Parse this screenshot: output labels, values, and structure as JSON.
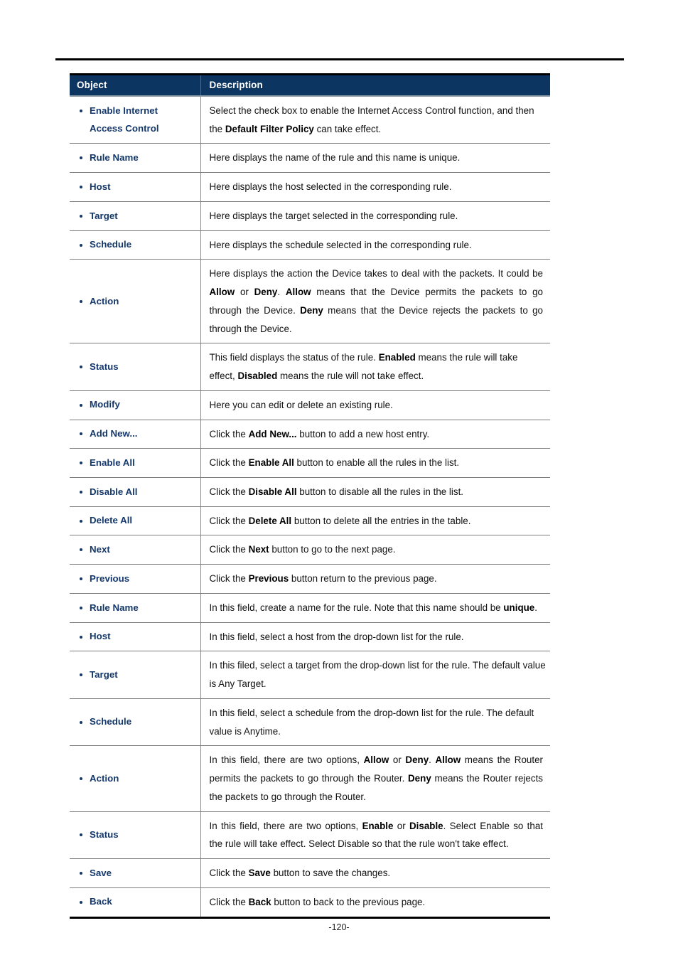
{
  "document": {
    "page_number": "-120-",
    "header_rule": true
  },
  "table": {
    "columns": [
      "Object",
      "Description"
    ],
    "rows": [
      {
        "object_lines": [
          "Enable Internet",
          "Access Control"
        ],
        "description_html": "Select the check box to enable the Internet Access Control function, and then the <b>Default Filter Policy</b> can take effect.",
        "justified": false
      },
      {
        "object_lines": [
          "Rule Name"
        ],
        "description_html": "Here displays the name of the rule and this name is unique.",
        "justified": false
      },
      {
        "object_lines": [
          "Host"
        ],
        "description_html": "Here displays the host selected in the corresponding rule.",
        "justified": false
      },
      {
        "object_lines": [
          "Target"
        ],
        "description_html": "Here displays the target selected in the corresponding rule.",
        "justified": false
      },
      {
        "object_lines": [
          "Schedule"
        ],
        "description_html": "Here displays the schedule selected in the corresponding rule.",
        "justified": false
      },
      {
        "object_lines": [
          "Action"
        ],
        "description_html": "Here displays the action the Device takes to deal with the packets. It could be <b>Allow</b> or <b>Deny</b>. <b>Allow</b> means that the Device permits the packets to go through the Device. <b>Deny</b> means that the Device rejects the packets to go through the Device.",
        "justified": true
      },
      {
        "object_lines": [
          "Status"
        ],
        "description_html": "This field displays the status of the rule. <b>Enabled</b> means the rule will take effect, <b>Disabled</b> means the rule will not take effect.",
        "justified": false
      },
      {
        "object_lines": [
          "Modify"
        ],
        "description_html": "Here you can edit or delete an existing rule.",
        "justified": false
      },
      {
        "object_lines": [
          "Add New..."
        ],
        "description_html": "Click the <b>Add New...</b> button to add a new host entry.",
        "justified": false
      },
      {
        "object_lines": [
          "Enable All"
        ],
        "description_html": "Click the <b>Enable All</b> button to enable all the rules in the list.",
        "justified": false
      },
      {
        "object_lines": [
          "Disable All"
        ],
        "description_html": "Click the <b>Disable All</b> button to disable all the rules in the list.",
        "justified": false
      },
      {
        "object_lines": [
          "Delete All"
        ],
        "description_html": "Click the <b>Delete All</b> button to delete all the entries in the table.",
        "justified": false
      },
      {
        "object_lines": [
          "Next"
        ],
        "description_html": "Click the <b>Next</b> button to go to the next page.",
        "justified": false
      },
      {
        "object_lines": [
          "Previous"
        ],
        "description_html": "Click the <b>Previous</b> button return to the previous page.",
        "justified": false
      },
      {
        "object_lines": [
          "Rule Name"
        ],
        "description_html": "In this field, create a name for the rule. Note that this name should be <b>unique</b>.",
        "justified": true
      },
      {
        "object_lines": [
          "Host"
        ],
        "description_html": "In this field, select a host from the drop-down list for the rule.",
        "justified": false
      },
      {
        "object_lines": [
          "Target"
        ],
        "description_html": "In this filed, select a target from the drop-down list for the rule. The default value is Any Target.",
        "justified": false
      },
      {
        "object_lines": [
          "Schedule"
        ],
        "description_html": "In this field, select a schedule from the drop-down list for the rule. The default value is Anytime.",
        "justified": false
      },
      {
        "object_lines": [
          "Action"
        ],
        "description_html": "In this field, there are two options, <b>Allow</b> or <b>Deny</b>. <b>Allow</b> means the Router permits the packets to go through the Router. <b>Deny</b> means the Router rejects the packets to go through the Router.",
        "justified": true
      },
      {
        "object_lines": [
          "Status"
        ],
        "description_html": "In this field, there are two options, <b>Enable</b> or <b>Disable</b>. Select Enable so that the rule will take effect. Select Disable so that the rule won't take effect.",
        "justified": true
      },
      {
        "object_lines": [
          "Save"
        ],
        "description_html": "Click the <b>Save</b> button to save the changes.",
        "justified": false
      },
      {
        "object_lines": [
          "Back"
        ],
        "description_html": "Click the <b>Back</b> button to back to the previous page.",
        "justified": false
      }
    ]
  },
  "colors": {
    "header_background": "#0d3562",
    "header_text": "#ffffff",
    "object_text": "#14386b",
    "rule_line": "#7c7c7c",
    "page_border": "#000000"
  }
}
